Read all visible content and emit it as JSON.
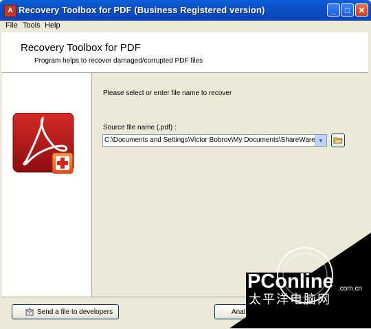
{
  "window": {
    "title": "Recovery Toolbox for PDF (Business Registered version)",
    "app_icon_glyph": "A"
  },
  "menu": [
    "File",
    "Tools",
    "Help"
  ],
  "header": {
    "title": "Recovery Toolbox for PDF",
    "subtitle": "Program helps to recover damaged/corrupted PDF files"
  },
  "main": {
    "prompt": "Please select or enter file name to recover",
    "source_label": "Source file name (.pdf) :",
    "source_value": "C:\\Documents and Settings\\Victor Bobrov\\My Documents\\ShareWare\\Te"
  },
  "buttons": {
    "send": "Send a file to developers",
    "analyze": "Anal"
  },
  "watermark": {
    "brand": "PConline",
    "domain": ".com.cn",
    "chinese": "太平洋电脑网"
  },
  "colors": {
    "titlebar": "#0a4ec6",
    "acrobat_red": "#b5161b",
    "plus_orange": "#f06a2a",
    "bg": "#ece9d8"
  }
}
